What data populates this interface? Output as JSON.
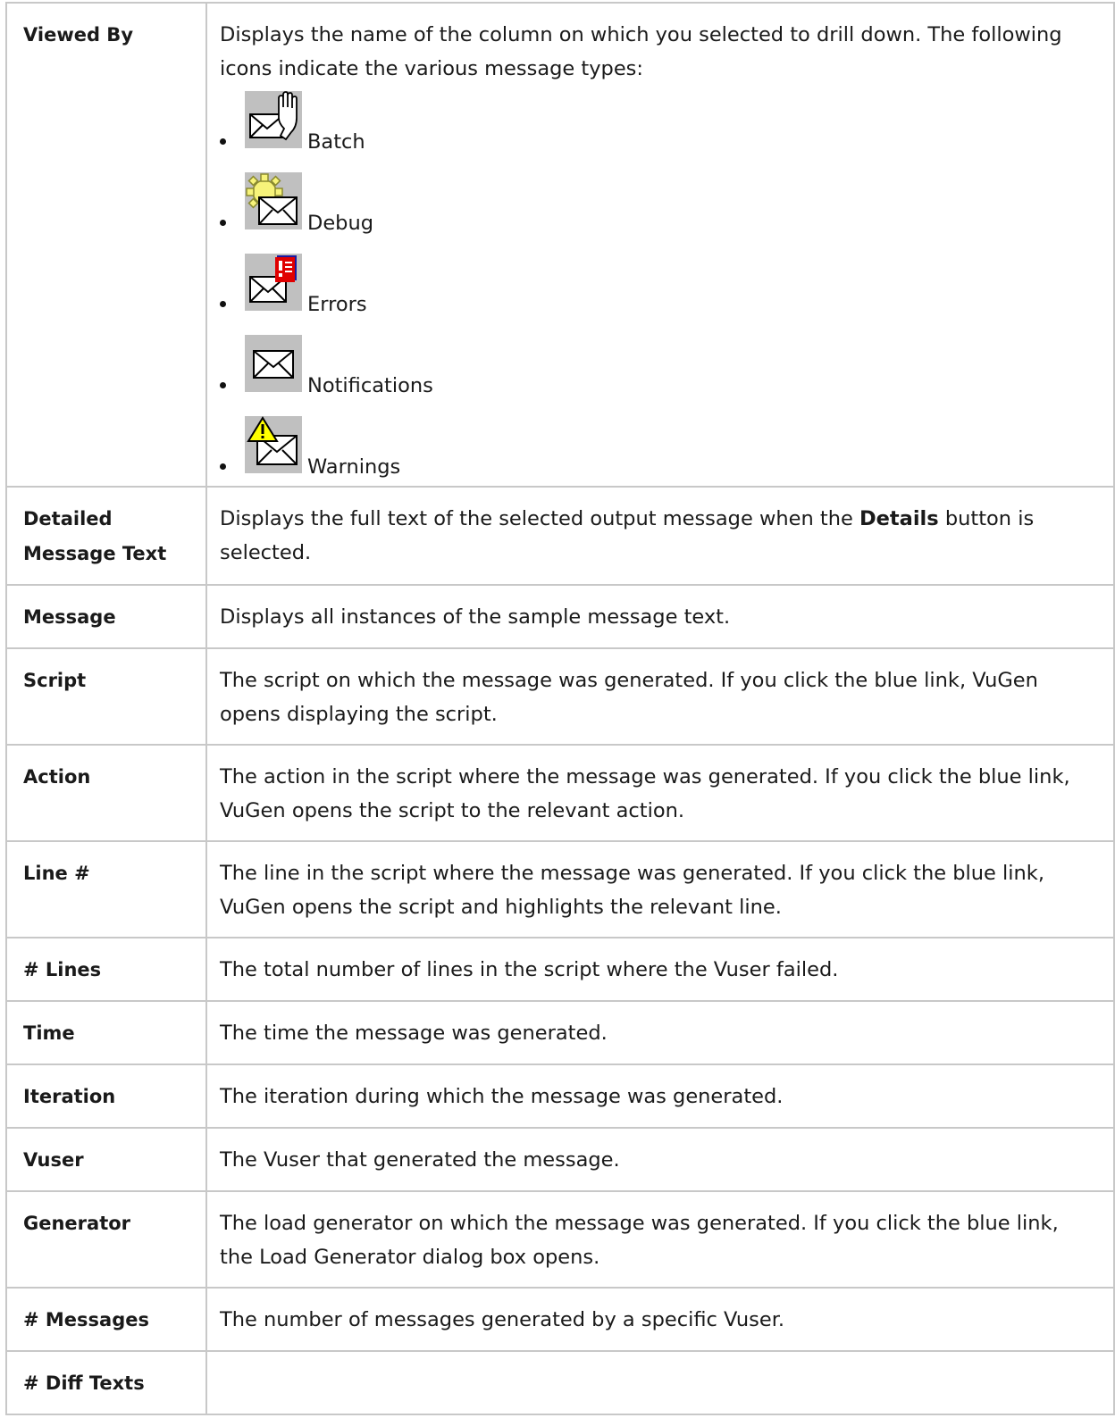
{
  "rows": [
    {
      "field": "Viewed By",
      "desc": "Displays the name of the column on which you selected to drill down. The following icons indicate the various message types:",
      "icons": [
        {
          "icon": "batch-message-icon",
          "label": "Batch"
        },
        {
          "icon": "debug-message-icon",
          "label": "Debug"
        },
        {
          "icon": "errors-message-icon",
          "label": "Errors"
        },
        {
          "icon": "notifications-message-icon",
          "label": "Notifications"
        },
        {
          "icon": "warnings-message-icon",
          "label": "Warnings"
        }
      ]
    },
    {
      "field": "Detailed Message Text",
      "desc_before": "Displays the full text of the selected output message when the ",
      "desc_bold": "Details",
      "desc_after": " button is selected."
    },
    {
      "field": "Message",
      "desc": "Displays all instances of the sample message text."
    },
    {
      "field": "Script",
      "desc": "The script on which the message was generated. If you click the blue link, VuGen opens displaying the script."
    },
    {
      "field": "Action",
      "desc": "The action in the script where the message was generated. If you click the blue link, VuGen opens the script to the relevant action."
    },
    {
      "field": "Line #",
      "desc": "The line in the script where the message was generated. If you click the blue link, VuGen opens the script and highlights the relevant line."
    },
    {
      "field": "# Lines",
      "desc": "The total number of lines in the script where the Vuser failed."
    },
    {
      "field": "Time",
      "desc": "The time the message was generated."
    },
    {
      "field": "Iteration",
      "desc": "The iteration during which the message was generated."
    },
    {
      "field": "Vuser",
      "desc": "The Vuser that generated the message."
    },
    {
      "field": "Generator",
      "desc": "The load generator on which the message was generated. If you click the blue link, the Load Generator dialog box opens."
    },
    {
      "field": "# Messages",
      "desc": "The number of messages generated by a specific Vuser."
    },
    {
      "field": "# Diff Texts",
      "desc": ""
    }
  ],
  "colors": {
    "border": "#c8c8c8",
    "icon_bg": "#c0c0c0",
    "error_red": "#e00000",
    "gear_yellow": "#f7f37a",
    "warning_yellow": "#ffff00"
  }
}
